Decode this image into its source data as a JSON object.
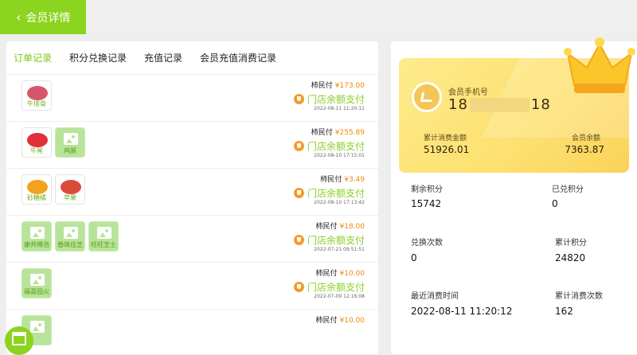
{
  "header": {
    "title": "会员详情"
  },
  "tabs": [
    "订单记录",
    "积分兑换记录",
    "充值记录",
    "会员充值消费记录"
  ],
  "orders": [
    {
      "payer": "柿民付",
      "amount": "¥173.00",
      "method": "门店余额支付",
      "time": "2022-08-11 11:20:11",
      "items": [
        {
          "name": "牛排骨",
          "type": "photo"
        }
      ]
    },
    {
      "payer": "柿民付",
      "amount": "¥255.89",
      "method": "门店余额支付",
      "time": "2022-08-10 17:15:01",
      "items": [
        {
          "name": "牛尾",
          "type": "photo"
        },
        {
          "name": "鸡腿",
          "type": "placeholder"
        }
      ]
    },
    {
      "payer": "柿民付",
      "amount": "¥3.49",
      "method": "门店余额支付",
      "time": "2022-08-10 17:13:42",
      "items": [
        {
          "name": "砂糖橘",
          "type": "photo"
        },
        {
          "name": "苹果",
          "type": "photo"
        }
      ]
    },
    {
      "payer": "柿民付",
      "amount": "¥18.00",
      "method": "门店余额支付",
      "time": "2022-07-21 09:51:51",
      "items": [
        {
          "name": "康师傅泡",
          "type": "placeholder"
        },
        {
          "name": "香味佳芝",
          "type": "placeholder"
        },
        {
          "name": "旺旺芝士",
          "type": "placeholder"
        }
      ]
    },
    {
      "payer": "柿民付",
      "amount": "¥10.00",
      "method": "门店余额支付",
      "time": "2022-07-09 12:16:08",
      "items": [
        {
          "name": "福喜园火",
          "type": "placeholder"
        }
      ]
    },
    {
      "payer": "柿民付",
      "amount": "¥10.00",
      "method": "",
      "time": "",
      "items": [
        {
          "name": "",
          "type": "placeholder"
        }
      ]
    }
  ],
  "card": {
    "phone_label": "会员手机号",
    "phone_prefix": "18",
    "phone_suffix": "18",
    "total_label": "累计消费金额",
    "total": "51926.01",
    "balance_label": "会员余额",
    "balance": "7363.87"
  },
  "stats": {
    "remaining_points_label": "剩余积分",
    "remaining_points": "15742",
    "exchanged_points_label": "已兑积分",
    "exchanged_points": "0",
    "exchange_count_label": "兑换次数",
    "exchange_count": "0",
    "total_points_label": "累计积分",
    "total_points": "24820",
    "last_time_label": "最近消费时间",
    "last_time": "2022-08-11 11:20:12",
    "consume_count_label": "累计消费次数",
    "consume_count": "162"
  },
  "colors": {
    "accent": "#8bd41f",
    "price": "#f0890a",
    "card": "#fde070"
  }
}
